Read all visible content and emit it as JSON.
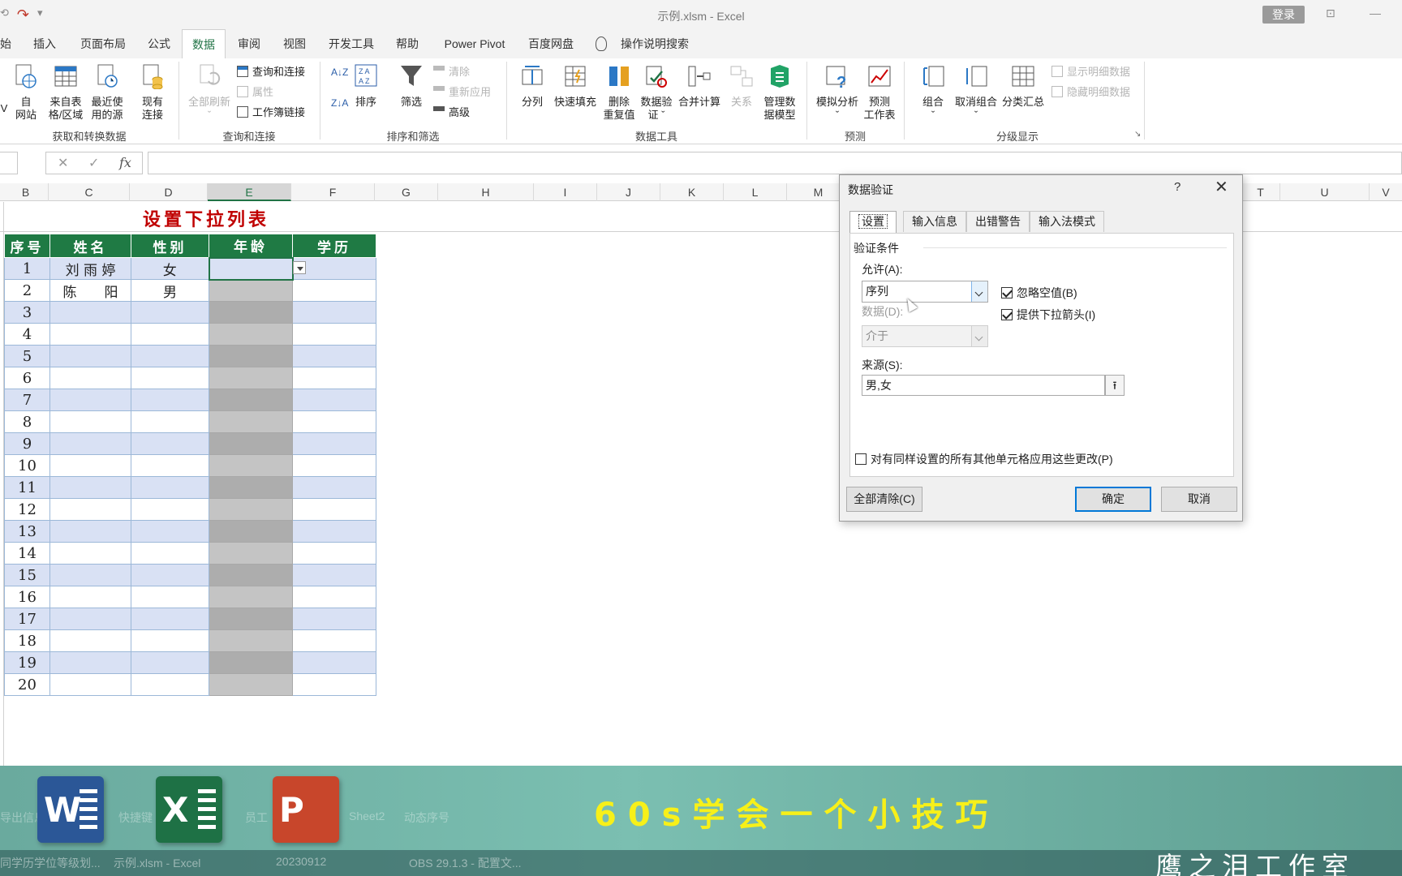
{
  "titlebar": {
    "title": "示例.xlsm  -  Excel",
    "login": "登录",
    "restore_glyph": "⊡",
    "minimize_glyph": "—"
  },
  "tabs": [
    "始",
    "插入",
    "页面布局",
    "公式",
    "数据",
    "审阅",
    "视图",
    "开发工具",
    "帮助",
    "Power Pivot",
    "百度网盘",
    "操作说明搜索"
  ],
  "ribbon": {
    "get_data": {
      "v": "V",
      "web": "自\n网站",
      "table": "来自表\n格/区域",
      "recent": "最近使\n用的源",
      "existing": "现有\n连接",
      "label": "获取和转换数据"
    },
    "queries": {
      "refresh_all": "全部刷新",
      "queries_conn": "查询和连接",
      "properties": "属性",
      "workbook_links": "工作簿链接",
      "label": "查询和连接"
    },
    "sort_filter": {
      "sort": "排序",
      "filter": "筛选",
      "clear": "清除",
      "reapply": "重新应用",
      "advanced": "高级",
      "label": "排序和筛选"
    },
    "data_tools": {
      "split": "分列",
      "flash_fill": "快速填充",
      "remove_dup": "删除\n重复值",
      "validation": "数据验\n证 ˇ",
      "consolidate": "合并计算",
      "relations": "关系",
      "data_model": "管理数\n据模型",
      "label": "数据工具"
    },
    "forecast": {
      "whatif": "模拟分析\nˇ",
      "sheet": "预测\n工作表",
      "label": "预测"
    },
    "outline": {
      "group": "组合\nˇ",
      "ungroup": "取消组合\nˇ",
      "subtotal": "分类汇总",
      "show_detail": "显示明细数据",
      "hide_detail": "隐藏明细数据",
      "label": "分级显示"
    }
  },
  "formula_bar": {
    "fx": "fx",
    "cancel": "✕",
    "enter": "✓"
  },
  "columns": [
    "B",
    "C",
    "D",
    "E",
    "F",
    "G",
    "H",
    "I",
    "J",
    "K",
    "L",
    "M",
    "T",
    "U",
    "V"
  ],
  "sheet": {
    "title": "设置下拉列表",
    "headers": [
      "序号",
      "姓名",
      "性别",
      "年龄",
      "学历"
    ],
    "rows": [
      [
        "1",
        "刘 雨 婷",
        "女"
      ],
      [
        "2",
        "陈　　阳",
        "男"
      ],
      [
        "3",
        "",
        ""
      ],
      [
        "4",
        "",
        ""
      ],
      [
        "5",
        "",
        ""
      ],
      [
        "6",
        "",
        ""
      ],
      [
        "7",
        "",
        ""
      ],
      [
        "8",
        "",
        ""
      ],
      [
        "9",
        "",
        ""
      ],
      [
        "10",
        "",
        ""
      ],
      [
        "11",
        "",
        ""
      ],
      [
        "12",
        "",
        ""
      ],
      [
        "13",
        "",
        ""
      ],
      [
        "14",
        "",
        ""
      ],
      [
        "15",
        "",
        ""
      ],
      [
        "16",
        "",
        ""
      ],
      [
        "17",
        "",
        ""
      ],
      [
        "18",
        "",
        ""
      ],
      [
        "19",
        "",
        ""
      ],
      [
        "20",
        "",
        ""
      ]
    ]
  },
  "dialog": {
    "title": "数据验证",
    "help": "?",
    "close": "✕",
    "tabs": [
      "设置",
      "输入信息",
      "出错警告",
      "输入法模式"
    ],
    "criteria_label": "验证条件",
    "allow_label": "允许(A):",
    "allow_value": "序列",
    "data_label": "数据(D):",
    "data_value": "介于",
    "ignore_blank": "忽略空值(B)",
    "in_cell_dropdown": "提供下拉箭头(I)",
    "source_label": "来源(S):",
    "source_value": "男,女",
    "apply_all": "对有同样设置的所有其他单元格应用这些更改(P)",
    "clear_all": "全部清除(C)",
    "ok": "确定",
    "cancel": "取消"
  },
  "banner": {
    "slogan": "60s学会一个小技巧",
    "studio": "鹰之泪工作室",
    "ghost_tabs": [
      "导出信息",
      "快捷键",
      "员工",
      "Sheet2",
      "动态序号"
    ],
    "taskbar": [
      "同学历学位等级划...",
      "示例.xlsm - Excel",
      "20230912",
      "OBS 29.1.3 - 配置文..."
    ],
    "app_letters": [
      "W",
      "X",
      "P"
    ]
  }
}
